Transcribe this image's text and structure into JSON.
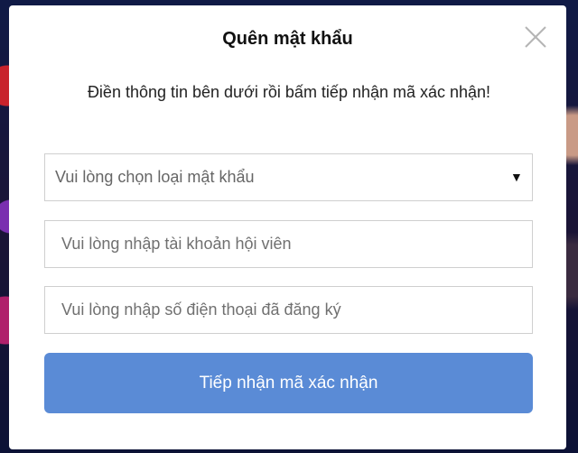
{
  "modal": {
    "title": "Quên mật khẩu",
    "instruction": "Điền thông tin bên dưới rồi bấm tiếp nhận mã xác nhận!",
    "close_icon": "close-icon"
  },
  "form": {
    "password_type": {
      "selected": "Vui lòng chọn loại mật khẩu",
      "arrow_icon": "caret-down-icon"
    },
    "account": {
      "value": "",
      "placeholder": "Vui lòng nhập tài khoản hội viên"
    },
    "phone": {
      "value": "",
      "placeholder": "Vui lòng nhập số điện thoại đã đăng ký"
    },
    "submit_label": "Tiếp nhận mã xác nhận"
  },
  "colors": {
    "button": "#5a8bd6",
    "button_text": "#ffffff",
    "border": "#cfcfcf"
  }
}
